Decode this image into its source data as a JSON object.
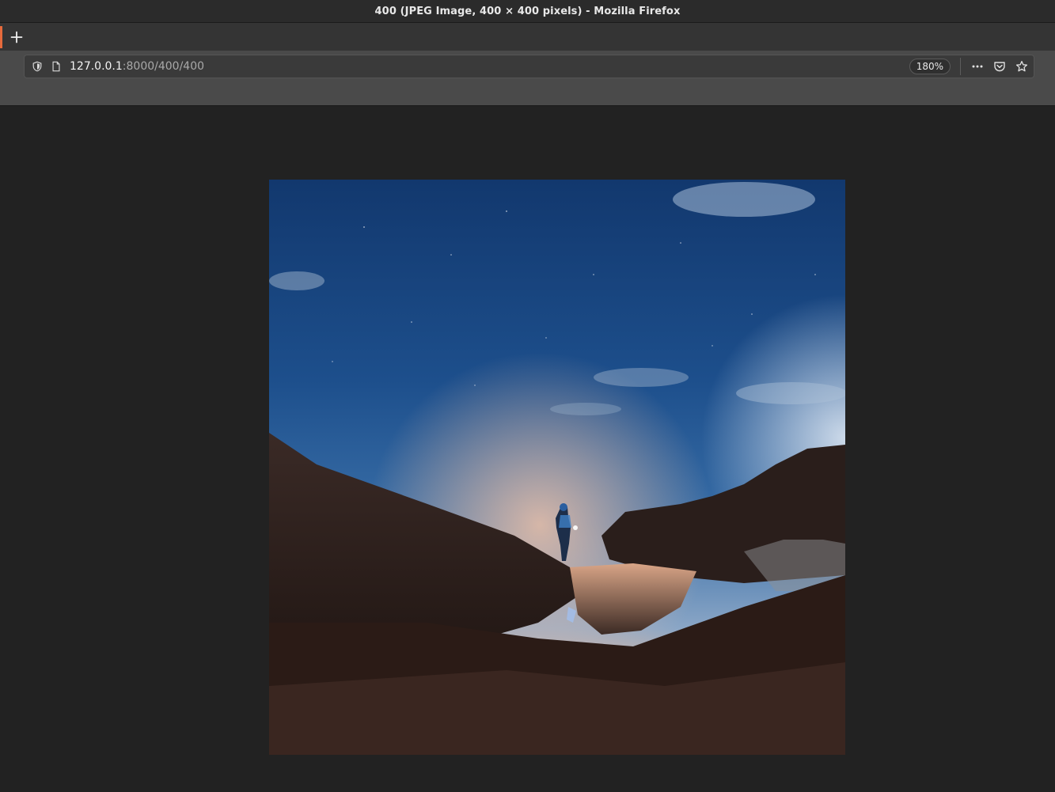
{
  "window": {
    "title": "400 (JPEG Image, 400 × 400 pixels) - Mozilla Firefox"
  },
  "tabs": {
    "new_tab_icon": "plus-icon"
  },
  "urlbar": {
    "url_host": "127.0.0.1",
    "url_path": ":8000/400/400",
    "zoom_label": "180%",
    "icons": [
      "shield-icon",
      "page-icon",
      "more-icon",
      "pocket-icon",
      "star-icon"
    ]
  },
  "colors": {
    "tab_accent": "#e66a3c",
    "page_background": "#222222"
  }
}
